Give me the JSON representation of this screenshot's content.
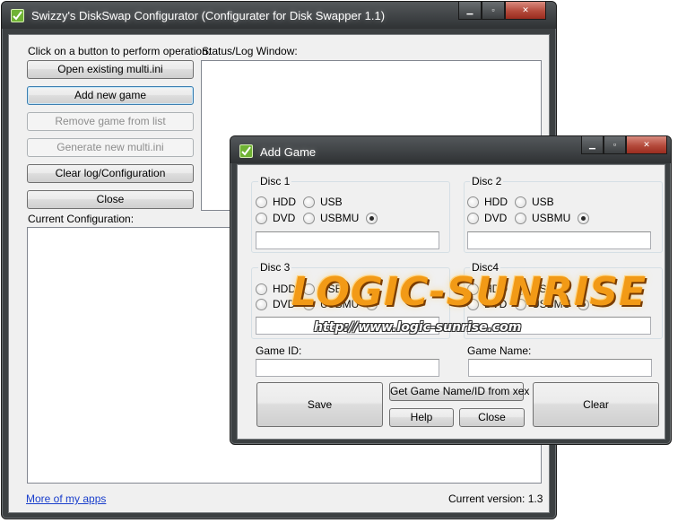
{
  "main_window": {
    "title": "Swizzy's DiskSwap Configurator (Configurater for Disk Swapper 1.1)",
    "controls": {
      "minimize": "▁",
      "maximize": "▫",
      "close": "✕"
    },
    "operation_label": "Click on a button to perform operation:",
    "status_label": "Status/Log Window:",
    "config_label": "Current Configuration:",
    "buttons": {
      "open": "Open existing multi.ini",
      "add": "Add new game",
      "remove": "Remove game from list",
      "generate": "Generate new multi.ini",
      "clear_log": "Clear log/Configuration",
      "close": "Close"
    },
    "more_apps_link": "More of my apps",
    "version": "Current version: 1.3"
  },
  "add_game_dialog": {
    "title": "Add Game",
    "controls": {
      "minimize": "▁",
      "maximize": "▫",
      "close": "✕"
    },
    "discs": [
      {
        "label": "Disc 1",
        "opt_hdd": "HDD",
        "opt_usb": "USB",
        "opt_dvd": "DVD",
        "opt_usbmu": "USBMU",
        "selected": "none"
      },
      {
        "label": "Disc 2",
        "opt_hdd": "HDD",
        "opt_usb": "USB",
        "opt_dvd": "DVD",
        "opt_usbmu": "USBMU",
        "selected": "none"
      },
      {
        "label": "Disc 3",
        "opt_hdd": "HDD",
        "opt_usb": "USB",
        "opt_dvd": "DVD",
        "opt_usbmu": "USBMU",
        "selected": "none"
      },
      {
        "label": "Disc4",
        "opt_hdd": "HDD",
        "opt_usb": "USB",
        "opt_dvd": "DVD",
        "opt_usbmu": "USBMU",
        "selected": "none"
      }
    ],
    "game_id_label": "Game ID:",
    "game_name_label": "Game Name:",
    "buttons": {
      "save": "Save",
      "get_name": "Get Game Name/ID from xex",
      "help": "Help",
      "close": "Close",
      "clear": "Clear"
    }
  },
  "watermark": {
    "title": "LOGIC-SUNRISE",
    "url": "http://www.logic-sunrise.com"
  },
  "colors": {
    "chrome_dark": "#3c4042",
    "client_bg": "#f0f0f0",
    "close_red": "#b44a3b",
    "watermark_orange": "#f29a16",
    "link_blue": "#1a3fcc"
  }
}
